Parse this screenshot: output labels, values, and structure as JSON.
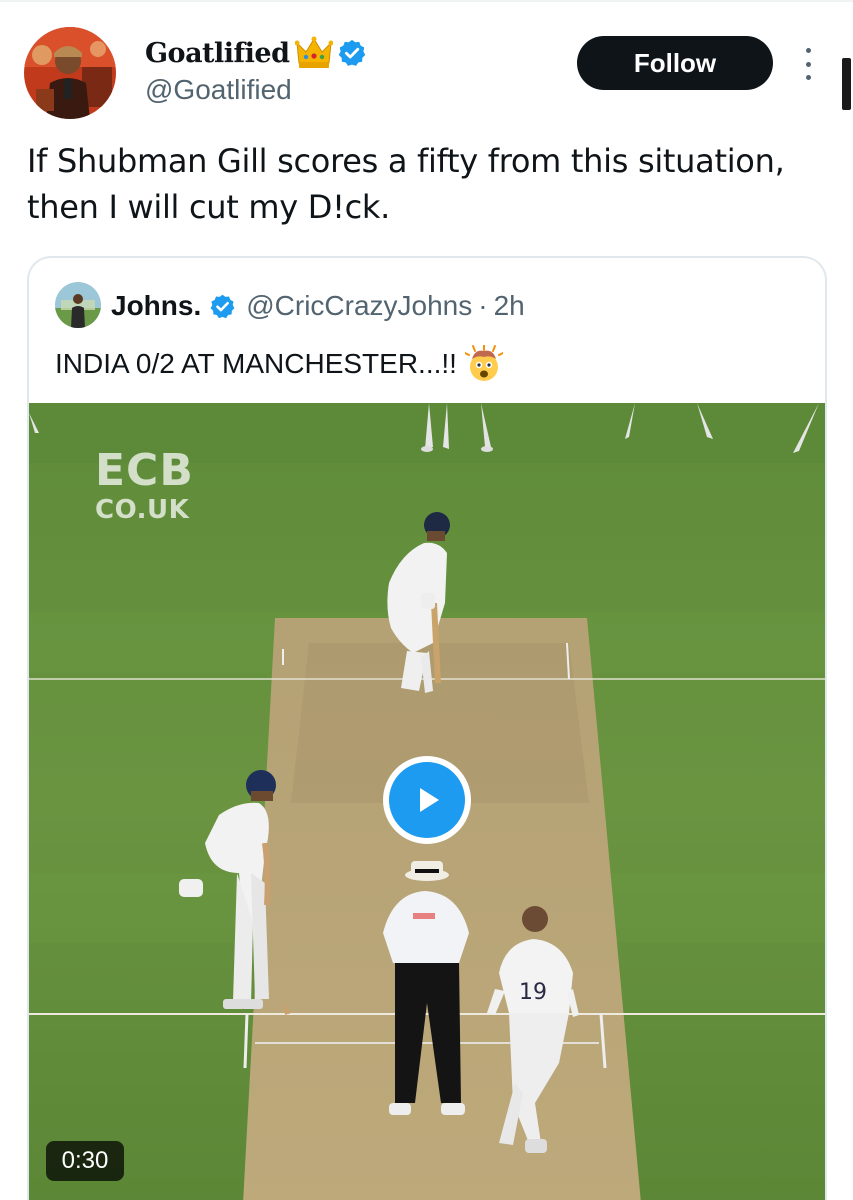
{
  "author": {
    "display_name": "Goatlified",
    "handle": "@Goatlified",
    "badge_emoji": "crown",
    "verified": true
  },
  "follow_button": {
    "label": "Follow"
  },
  "more_button": {
    "icon": "more-vertical-icon"
  },
  "tweet": {
    "text": "If Shubman Gill scores a fifty from this situation, then I will cut my D!ck."
  },
  "quoted_tweet": {
    "display_name": "Johns.",
    "handle": "@CricCrazyJohns",
    "separator": "·",
    "time": "2h",
    "verified": true,
    "text": "INDIA 0/2 AT MANCHESTER...!!",
    "emoji": "exploding-head",
    "video": {
      "watermark_line1": "ECB",
      "watermark_line2": "CO.UK",
      "duration": "0:30",
      "bowler_shirt_number": "19"
    }
  },
  "colors": {
    "accent": "#1d9bf0",
    "follow_bg": "#0f1419",
    "secondary_text": "#536471",
    "pitch_grass": "#5f8c3a"
  }
}
